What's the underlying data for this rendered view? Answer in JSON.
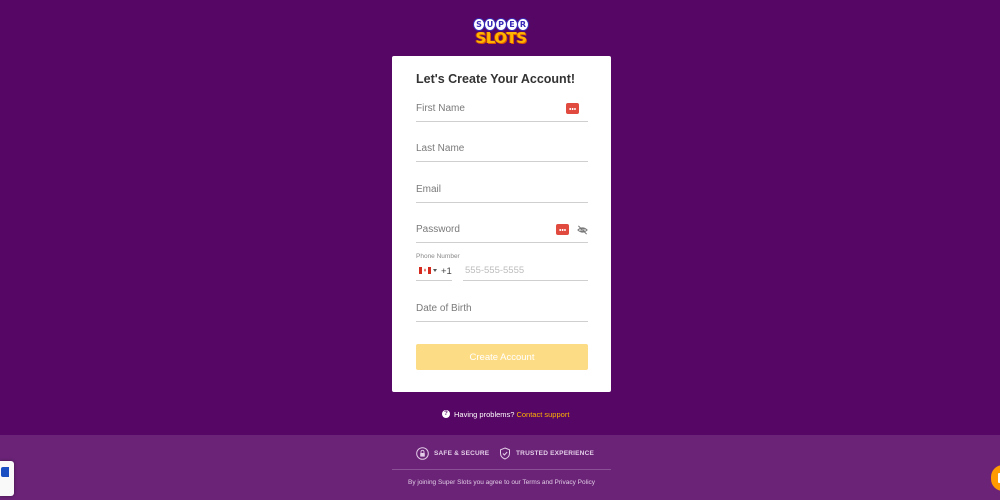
{
  "brand": {
    "logo_letters": [
      "S",
      "U",
      "P",
      "E",
      "R"
    ],
    "logo_word": "SLOTS"
  },
  "form": {
    "title": "Let's Create Your Account!",
    "first_name_placeholder": "First Name",
    "last_name_placeholder": "Last Name",
    "email_placeholder": "Email",
    "password_placeholder": "Password",
    "phone_label": "Phone Number",
    "dial_code": "+1",
    "phone_placeholder": "555-555-5555",
    "dob_placeholder": "Date of Birth",
    "submit_label": "Create Account"
  },
  "help": {
    "text": "Having problems?",
    "link": "Contact support"
  },
  "footer": {
    "badge_secure": "SAFE & SECURE",
    "badge_trusted": "TRUSTED EXPERIENCE",
    "terms": "By joining Super Slots you agree to our Terms and Privacy Policy"
  },
  "colors": {
    "page_bg": "#560664",
    "footer_bg": "#6a2377",
    "accent": "#ffb400",
    "button_bg": "#fddc86",
    "password_manager_icon": "#e04a3f"
  },
  "icons": {
    "password_manager": "password-manager-icon",
    "eye": "eye-off-icon",
    "flag": "canada-flag-icon",
    "help": "question-circle-icon",
    "lock": "lock-icon",
    "shield": "shield-check-icon"
  }
}
